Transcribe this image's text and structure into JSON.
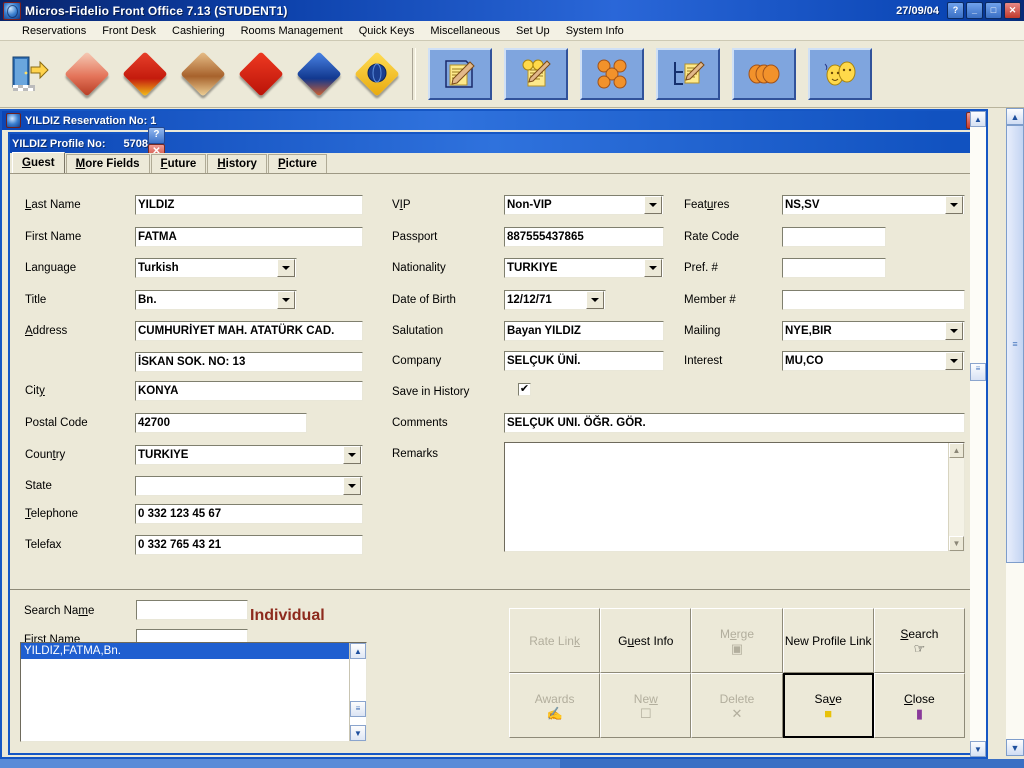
{
  "window": {
    "title": "Micros-Fidelio Front Office 7.13 (STUDENT1)",
    "date": "27/09/04",
    "help_btn": "?",
    "min_btn": "_",
    "max_btn": "□",
    "close_btn": "✕"
  },
  "menu": {
    "items": [
      "Reservations",
      "Front Desk",
      "Cashiering",
      "Rooms Management",
      "Quick Keys",
      "Miscellaneous",
      "Set Up",
      "System Info"
    ]
  },
  "toolbar": {
    "group1": [
      {
        "name": "exit-icon",
        "color": "#3f7fbf"
      },
      {
        "name": "reservation-icon",
        "color": "#e3a08a"
      },
      {
        "name": "front-desk-icon",
        "color": "#d62b1a"
      },
      {
        "name": "cashiering-icon",
        "color": "#c08a4a"
      },
      {
        "name": "rooms-management-icon",
        "color": "#e01c10"
      },
      {
        "name": "quick-keys-icon",
        "color": "#2b57c8"
      },
      {
        "name": "reports-icon",
        "color": "#f2c012"
      }
    ],
    "group2": [
      {
        "name": "new-reservation-icon"
      },
      {
        "name": "edit-reservation-icon"
      },
      {
        "name": "group-reservation-icon"
      },
      {
        "name": "room-plan-icon"
      },
      {
        "name": "billing-icon"
      },
      {
        "name": "profiles-icon"
      }
    ]
  },
  "reservation_window": {
    "title": "YILDIZ Reservation No: 1",
    "close_btn": "✕"
  },
  "profile_window": {
    "title": "YILDIZ Profile No:",
    "number": "5708",
    "help_btn": "?",
    "close_btn": "✕"
  },
  "tabs": [
    {
      "label": "Guest",
      "accel": "G",
      "active": true
    },
    {
      "label": "More Fields",
      "accel": "M",
      "active": false
    },
    {
      "label": "Future",
      "accel": "F",
      "active": false
    },
    {
      "label": "History",
      "accel": "H",
      "active": false
    },
    {
      "label": "Picture",
      "accel": "P",
      "active": false
    }
  ],
  "form": {
    "col1": {
      "last_name": {
        "label": "Last Name",
        "value": "YILDIZ"
      },
      "first_name": {
        "label": "First Name",
        "value": "FATMA"
      },
      "language": {
        "label": "Language",
        "value": "Turkish"
      },
      "title": {
        "label": "Title",
        "value": "Bn."
      },
      "address": {
        "label": "Address",
        "value": "CUMHURİYET MAH. ATATÜRK CAD."
      },
      "address2": {
        "label": "",
        "value": "İSKAN SOK. NO: 13"
      },
      "city": {
        "label": "City",
        "value": "KONYA"
      },
      "postal_code": {
        "label": "Postal Code",
        "value": "42700"
      },
      "country": {
        "label": "Country",
        "value": "TURKIYE"
      },
      "state": {
        "label": "State",
        "value": ""
      },
      "telephone": {
        "label": "Telephone",
        "value": "0 332 123 45 67"
      },
      "telefax": {
        "label": "Telefax",
        "value": "0 332 765 43 21"
      }
    },
    "col2": {
      "vip": {
        "label": "VIP",
        "value": "Non-VIP"
      },
      "passport": {
        "label": "Passport",
        "value": "887555437865"
      },
      "nationality": {
        "label": "Nationality",
        "value": "TURKIYE"
      },
      "date_of_birth": {
        "label": "Date of Birth",
        "value": "12/12/71"
      },
      "salutation": {
        "label": "Salutation",
        "value": "Bayan YILDIZ"
      },
      "company": {
        "label": "Company",
        "value": "SELÇUK ÜNİ."
      },
      "save_in_history": {
        "label": "Save in History",
        "checked": true,
        "mark": "✔"
      },
      "comments": {
        "label": "Comments",
        "value": "SELÇUK UNI. ÖĞR. GÖR."
      },
      "remarks": {
        "label": "Remarks",
        "value": ""
      }
    },
    "col3": {
      "features": {
        "label": "Features",
        "value": "NS,SV"
      },
      "rate_code": {
        "label": "Rate Code",
        "value": ""
      },
      "pref_no": {
        "label": "Pref. #",
        "value": ""
      },
      "member_no": {
        "label": "Member #",
        "value": ""
      },
      "mailing": {
        "label": "Mailing",
        "value": "NYE,BIR"
      },
      "interest": {
        "label": "Interest",
        "value": "MU,CO"
      }
    }
  },
  "search_panel": {
    "search_name": {
      "label": "Search Name",
      "value": "",
      "accel": "m"
    },
    "first_name": {
      "label": "First Name",
      "value": ""
    },
    "type_label": "Individual",
    "results": [
      {
        "text": "YILDIZ,FATMA,Bn.",
        "selected": true
      }
    ]
  },
  "action_buttons": [
    {
      "label": "Rate Link",
      "accel": "k",
      "disabled": true,
      "icon": "",
      "default": false
    },
    {
      "label": "Guest Info",
      "accel": "u",
      "disabled": false,
      "icon": "",
      "default": false
    },
    {
      "label": "Merge",
      "accel": "e",
      "disabled": true,
      "icon": "▣",
      "default": false
    },
    {
      "label": "New Profile Link",
      "accel": "",
      "disabled": false,
      "icon": "",
      "default": false
    },
    {
      "label": "Search",
      "accel": "S",
      "disabled": false,
      "icon": "☞",
      "default": false
    },
    {
      "label": "Awards",
      "accel": "",
      "disabled": true,
      "icon": "✍",
      "default": false
    },
    {
      "label": "New",
      "accel": "w",
      "disabled": true,
      "icon": "☐",
      "default": false
    },
    {
      "label": "Delete",
      "accel": "",
      "disabled": true,
      "icon": "✕",
      "default": false
    },
    {
      "label": "Save",
      "accel": "v",
      "disabled": false,
      "icon": "■",
      "default": true
    },
    {
      "label": "Close",
      "accel": "C",
      "disabled": false,
      "icon": "▮",
      "default": false
    }
  ],
  "scrollbars": {
    "up_arrow": "▲",
    "down_arrow": "▼",
    "right_arrow": "▶",
    "grip": "≡"
  },
  "colors": {
    "window_bg": "#ece9d8",
    "titlebar_blue": "#0b46b5",
    "accent_red": "#8d2a1d",
    "selection_blue": "#1f5fd0"
  }
}
